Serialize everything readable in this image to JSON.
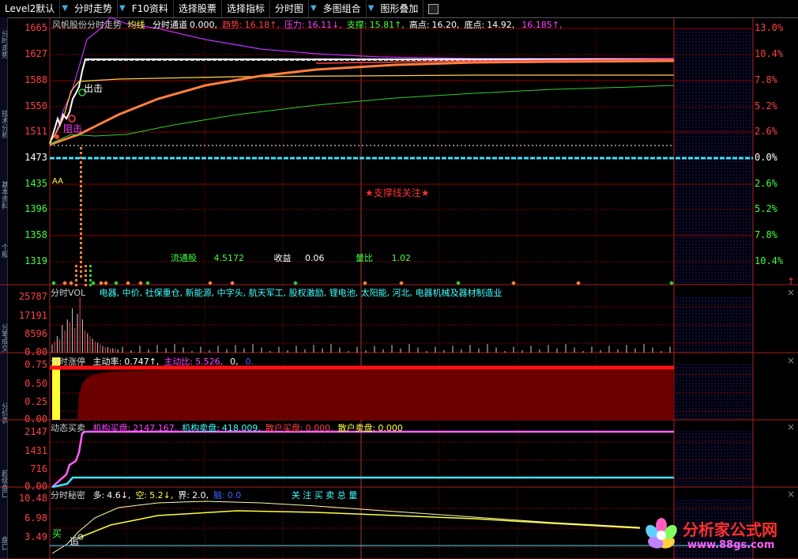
{
  "toolbar": {
    "items": [
      "Level2默认",
      "分时走势",
      "F10资料",
      "选择股票",
      "选择指标",
      "分时图",
      "多图组合",
      "图形叠加"
    ]
  },
  "side_tabs": [
    "分时走势",
    "技术分析",
    "基本资料",
    "个股",
    "分笔成交",
    "分价表",
    "超级盘口",
    "盘口"
  ],
  "main_pane": {
    "title": "风帆股份分时走势",
    "indicator_name": "均线",
    "params": [
      {
        "label": "分时通道",
        "value": "0.000,",
        "color": "#ffffff"
      },
      {
        "label": "趋势:",
        "value": "16.18↑,",
        "color": "#ff4040"
      },
      {
        "label": "压力:",
        "value": "16.11↓,",
        "color": "#ff40ff"
      },
      {
        "label": "支撑:",
        "value": "15.81↑,",
        "color": "#40ff40"
      },
      {
        "label": "高点:",
        "value": "16.20,",
        "color": "#ffffff"
      },
      {
        "label": "底点:",
        "value": "14.92,",
        "color": "#ffffff"
      },
      {
        "label": "",
        "value": "16.185↑,",
        "color": "#ff40ff"
      }
    ],
    "left_axis": [
      "1665",
      "1627",
      "1588",
      "1550",
      "1511",
      "1473",
      "1435",
      "1396",
      "1358",
      "1319"
    ],
    "right_axis": [
      "13.0%",
      "10.4%",
      "7.8%",
      "5.2%",
      "2.6%",
      "0.0%",
      "2.6%",
      "5.2%",
      "7.8%",
      "10.4%"
    ],
    "markers": {
      "chuji": "出击",
      "zuji": "阻击",
      "aa": "AA",
      "support_focus": "★支撑线关注★"
    },
    "stats": [
      {
        "label": "流通股",
        "value": "4.5172"
      },
      {
        "label": "收益",
        "value": "0.06"
      },
      {
        "label": "量比",
        "value": "1.02"
      }
    ]
  },
  "vol_pane": {
    "title": "分时VOL",
    "concepts": "电器, 中价, 社保重仓, 新能源, 中字头, 航天军工, 股权激励, 锂电池, 太阳能, 河北, 电器机械及器材制造业",
    "axis": [
      "25787",
      "17191",
      "8596",
      "0.00"
    ]
  },
  "limit_pane": {
    "title": "分时涨停",
    "params": [
      {
        "label": "主动率:",
        "value": "0.747↑,",
        "color": "#ffffff"
      },
      {
        "label": "主动比:",
        "value": "5.526,",
        "color": "#ff40ff"
      },
      {
        "label": "",
        "value": "0,",
        "color": "#ffffff"
      },
      {
        "label": "",
        "value": "0.",
        "color": "#4060ff"
      }
    ],
    "axis": [
      "0.75",
      "0.50",
      "0.25",
      "0.00"
    ]
  },
  "trade_pane": {
    "title": "动态买卖",
    "params": [
      {
        "label": "机构买盘:",
        "value": "2147.167,",
        "color": "#ff40ff"
      },
      {
        "label": "机构卖盘:",
        "value": "418.009,",
        "color": "#40ffff"
      },
      {
        "label": "散户买盘:",
        "value": "0.000,",
        "color": "#ff4040"
      },
      {
        "label": "散户卖盘:",
        "value": "0.000",
        "color": "#ffff40"
      }
    ],
    "axis": [
      "2147",
      "1431",
      "716",
      "0.00"
    ]
  },
  "secret_pane": {
    "title": "分时秘密",
    "params": [
      {
        "label": "多:",
        "value": "4.6↓,",
        "color": "#ffffff"
      },
      {
        "label": "空:",
        "value": "5.2↓,",
        "color": "#ffff40"
      },
      {
        "label": "界:",
        "value": "2.0,",
        "color": "#ffffff"
      },
      {
        "label": "脑:",
        "value": "0.0",
        "color": "#4060ff"
      }
    ],
    "focus": "关 注 买 卖 总 量",
    "axis": [
      "10.48",
      "6.98",
      "3.49"
    ],
    "buy_label": "买",
    "chase_label": "追"
  },
  "watermark": {
    "name": "分析家公式网",
    "url": "www.88gs.com"
  },
  "colors": {
    "grid": "#8b0000",
    "up": "#ff3030",
    "down": "#30ff30",
    "zero": "#40e0ff"
  }
}
